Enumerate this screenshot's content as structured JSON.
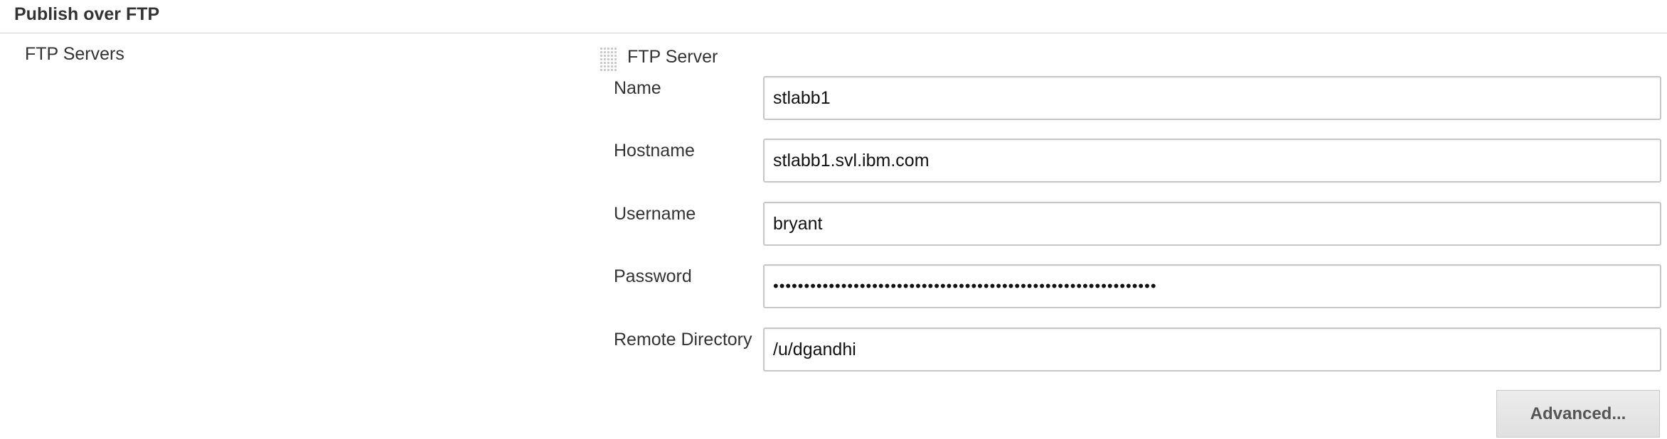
{
  "section": {
    "title": "Publish over FTP"
  },
  "servers": {
    "label": "FTP Servers",
    "server_title": "FTP Server",
    "fields": {
      "name": {
        "label": "Name",
        "value": "stlabb1"
      },
      "hostname": {
        "label": "Hostname",
        "value": "stlabb1.svl.ibm.com"
      },
      "username": {
        "label": "Username",
        "value": "bryant"
      },
      "password": {
        "label": "Password",
        "value": "••••••••••••••••••••••••••••••••••••••••••••••••••••••••••••••"
      },
      "remote_directory": {
        "label": "Remote Directory",
        "value": "/u/dgandhi"
      }
    },
    "advanced_label": "Advanced..."
  },
  "icons": {
    "drag_handle": "drag-handle-icon"
  }
}
